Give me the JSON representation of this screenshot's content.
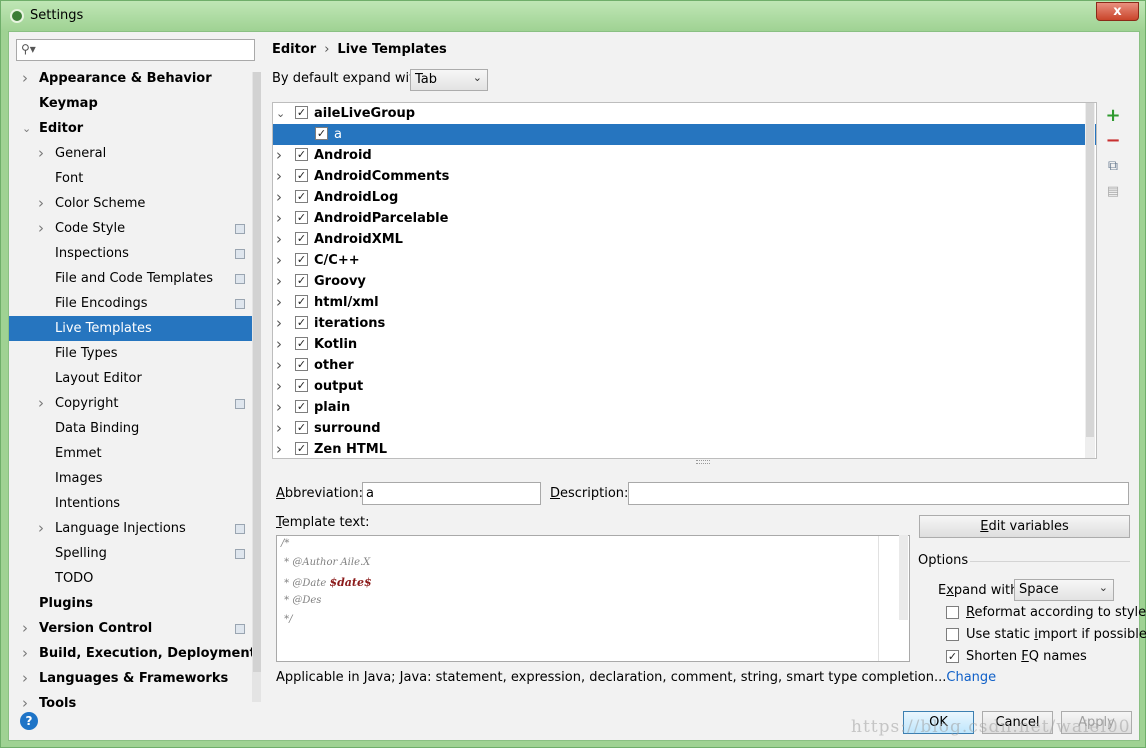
{
  "window": {
    "title": "Settings",
    "close_glyph": "x"
  },
  "search": {
    "placeholder": ""
  },
  "sidebar": {
    "items": [
      {
        "label": "Appearance & Behavior",
        "level": 0,
        "arrow": true,
        "bold": true
      },
      {
        "label": "Keymap",
        "level": 0,
        "arrow": false,
        "bold": true
      },
      {
        "label": "Editor",
        "level": 0,
        "arrow": "down",
        "bold": true
      },
      {
        "label": "General",
        "level": 1,
        "arrow": true,
        "bold": false
      },
      {
        "label": "Font",
        "level": 1,
        "arrow": false,
        "bold": false
      },
      {
        "label": "Color Scheme",
        "level": 1,
        "arrow": true,
        "bold": false
      },
      {
        "label": "Code Style",
        "level": 1,
        "arrow": true,
        "bold": false,
        "project_icon": true
      },
      {
        "label": "Inspections",
        "level": 1,
        "arrow": false,
        "bold": false,
        "project_icon": true
      },
      {
        "label": "File and Code Templates",
        "level": 1,
        "arrow": false,
        "bold": false,
        "project_icon": true
      },
      {
        "label": "File Encodings",
        "level": 1,
        "arrow": false,
        "bold": false,
        "project_icon": true
      },
      {
        "label": "Live Templates",
        "level": 1,
        "arrow": false,
        "bold": false,
        "selected": true
      },
      {
        "label": "File Types",
        "level": 1,
        "arrow": false,
        "bold": false
      },
      {
        "label": "Layout Editor",
        "level": 1,
        "arrow": false,
        "bold": false
      },
      {
        "label": "Copyright",
        "level": 1,
        "arrow": true,
        "bold": false,
        "project_icon": true
      },
      {
        "label": "Data Binding",
        "level": 1,
        "arrow": false,
        "bold": false
      },
      {
        "label": "Emmet",
        "level": 1,
        "arrow": false,
        "bold": false
      },
      {
        "label": "Images",
        "level": 1,
        "arrow": false,
        "bold": false
      },
      {
        "label": "Intentions",
        "level": 1,
        "arrow": false,
        "bold": false
      },
      {
        "label": "Language Injections",
        "level": 1,
        "arrow": true,
        "bold": false,
        "project_icon": true
      },
      {
        "label": "Spelling",
        "level": 1,
        "arrow": false,
        "bold": false,
        "project_icon": true
      },
      {
        "label": "TODO",
        "level": 1,
        "arrow": false,
        "bold": false
      },
      {
        "label": "Plugins",
        "level": 0,
        "arrow": false,
        "bold": true
      },
      {
        "label": "Version Control",
        "level": 0,
        "arrow": true,
        "bold": true,
        "project_icon": true
      },
      {
        "label": "Build, Execution, Deployment",
        "level": 0,
        "arrow": true,
        "bold": true
      },
      {
        "label": "Languages & Frameworks",
        "level": 0,
        "arrow": true,
        "bold": true
      },
      {
        "label": "Tools",
        "level": 0,
        "arrow": true,
        "bold": true
      }
    ]
  },
  "breadcrumb": {
    "parent": "Editor",
    "separator": "›",
    "current": "Live Templates"
  },
  "expand_default": {
    "label": "By default expand with",
    "value": "Tab"
  },
  "template_groups": [
    {
      "label": "aileLiveGroup",
      "expanded": true,
      "checked": true
    },
    {
      "label": "a",
      "child": true,
      "checked": true,
      "selected": true
    },
    {
      "label": "Android",
      "checked": true
    },
    {
      "label": "AndroidComments",
      "checked": true
    },
    {
      "label": "AndroidLog",
      "checked": true
    },
    {
      "label": "AndroidParcelable",
      "checked": true
    },
    {
      "label": "AndroidXML",
      "checked": true
    },
    {
      "label": "C/C++",
      "checked": true
    },
    {
      "label": "Groovy",
      "checked": true
    },
    {
      "label": "html/xml",
      "checked": true
    },
    {
      "label": "iterations",
      "checked": true
    },
    {
      "label": "Kotlin",
      "checked": true
    },
    {
      "label": "other",
      "checked": true
    },
    {
      "label": "output",
      "checked": true
    },
    {
      "label": "plain",
      "checked": true
    },
    {
      "label": "surround",
      "checked": true
    },
    {
      "label": "Zen HTML",
      "checked": true
    }
  ],
  "toolbar": {
    "add_glyph": "+",
    "remove_glyph": "−",
    "copy_glyph": "⧉",
    "move_glyph": "▤"
  },
  "abbreviation": {
    "label_mnemonic": "A",
    "label_rest": "bbreviation:",
    "value": "a"
  },
  "description": {
    "label_mnemonic": "D",
    "label_rest": "escription:",
    "value": ""
  },
  "template_text": {
    "label_mnemonic": "T",
    "label_rest": "emplate text:",
    "lines": [
      {
        "text": "/*",
        "var": ""
      },
      {
        "text": " * @Author Aile.X",
        "var": ""
      },
      {
        "text": " * @Date ",
        "var": "$date$"
      },
      {
        "text": " * @Des",
        "var": ""
      },
      {
        "text": " */",
        "var": ""
      }
    ]
  },
  "edit_variables": {
    "mnemonic": "E",
    "rest": "dit variables"
  },
  "options": {
    "title": "Options",
    "expand_with": {
      "label_pre": "E",
      "label_mnemonic": "x",
      "label_rest": "pand with",
      "value": "Space"
    },
    "checkboxes": [
      {
        "pre": "",
        "mnemonic": "R",
        "rest": "eformat according to style",
        "checked": false
      },
      {
        "pre": "Use static ",
        "mnemonic": "i",
        "rest": "mport if possible",
        "checked": false
      },
      {
        "pre": "Shorten ",
        "mnemonic": "F",
        "rest": "Q names",
        "checked": true
      }
    ]
  },
  "applicable": {
    "text": "Applicable in Java; Java: statement, expression, declaration, comment, string, smart type completion...",
    "link": "Change"
  },
  "buttons": {
    "ok": "OK",
    "cancel": "Cancel",
    "apply": "Apply",
    "help": "?"
  },
  "watermark": "https://blog.csdn.net/waiel00"
}
